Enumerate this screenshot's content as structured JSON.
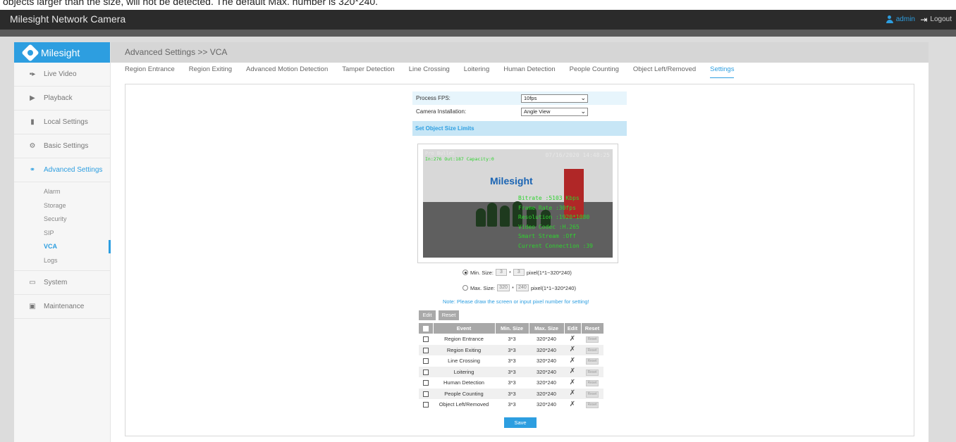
{
  "caption": "objects larger than the size, will not be detected. The default Max. number is 320*240.",
  "app": {
    "title": "Milesight Network Camera",
    "user": "admin",
    "logout": "Logout",
    "logo": "Milesight"
  },
  "sidebar": {
    "items": [
      {
        "label": "Live Video",
        "icon": "video-icon"
      },
      {
        "label": "Playback",
        "icon": "playback-icon"
      },
      {
        "label": "Local Settings",
        "icon": "folder-icon"
      },
      {
        "label": "Basic Settings",
        "icon": "gear-icon"
      },
      {
        "label": "Advanced Settings",
        "icon": "advanced-settings-icon"
      },
      {
        "label": "System",
        "icon": "monitor-icon"
      },
      {
        "label": "Maintenance",
        "icon": "maintenance-icon"
      }
    ],
    "sub_items": [
      "Alarm",
      "Storage",
      "Security",
      "SIP",
      "VCA",
      "Logs"
    ]
  },
  "breadcrumb": "Advanced Settings >> VCA",
  "tabs": [
    "Region Entrance",
    "Region Exiting",
    "Advanced Motion Detection",
    "Tamper Detection",
    "Line Crossing",
    "Loitering",
    "Human Detection",
    "People Counting",
    "Object Left/Removed",
    "Settings"
  ],
  "settings": {
    "fps_label": "Process FPS:",
    "fps_value": "10fps",
    "install_label": "Camera Installation:",
    "install_value": "Angle View",
    "section_title": "Set Object Size Limits"
  },
  "video": {
    "osd_name": "Pro Bullet",
    "osd_count": "In:276 Out:187 Capacity:0",
    "osd_time": "07/16/2020 14:48:25",
    "logo": "Milesight",
    "info_lines": [
      "Bitrate :5103 Kbps",
      "Frame Rate :30fps",
      "Resolution :1920*1080",
      "Video Codec :H.265",
      "Smart Stream :Off",
      "Current Connection :39"
    ]
  },
  "size": {
    "min_label": "Min. Size:",
    "min_w": "3",
    "min_h": "3",
    "min_range": "pixel(1*1~320*240)",
    "max_label": "Max. Size:",
    "max_w": "320",
    "max_h": "240",
    "max_range": "pixel(1*1~320*240)",
    "times": "*",
    "note": "Note: Please draw the screen or input pixel number for setting!"
  },
  "buttons": {
    "edit": "Edit",
    "reset": "Reset",
    "save": "Save",
    "row_reset": "Reset"
  },
  "table": {
    "headers": [
      "Event",
      "Min. Size",
      "Max. Size",
      "Edit",
      "Reset"
    ],
    "rows": [
      {
        "event": "Region Entrance",
        "min": "3*3",
        "max": "320*240"
      },
      {
        "event": "Region Exiting",
        "min": "3*3",
        "max": "320*240"
      },
      {
        "event": "Line Crossing",
        "min": "3*3",
        "max": "320*240"
      },
      {
        "event": "Loitering",
        "min": "3*3",
        "max": "320*240"
      },
      {
        "event": "Human Detection",
        "min": "3*3",
        "max": "320*240"
      },
      {
        "event": "People Counting",
        "min": "3*3",
        "max": "320*240"
      },
      {
        "event": "Object Left/Removed",
        "min": "3*3",
        "max": "320*240"
      }
    ]
  },
  "colors": {
    "accent": "#2d9ee0",
    "topbar": "#2b2b2b",
    "header_gray": "#a8a8a8"
  }
}
